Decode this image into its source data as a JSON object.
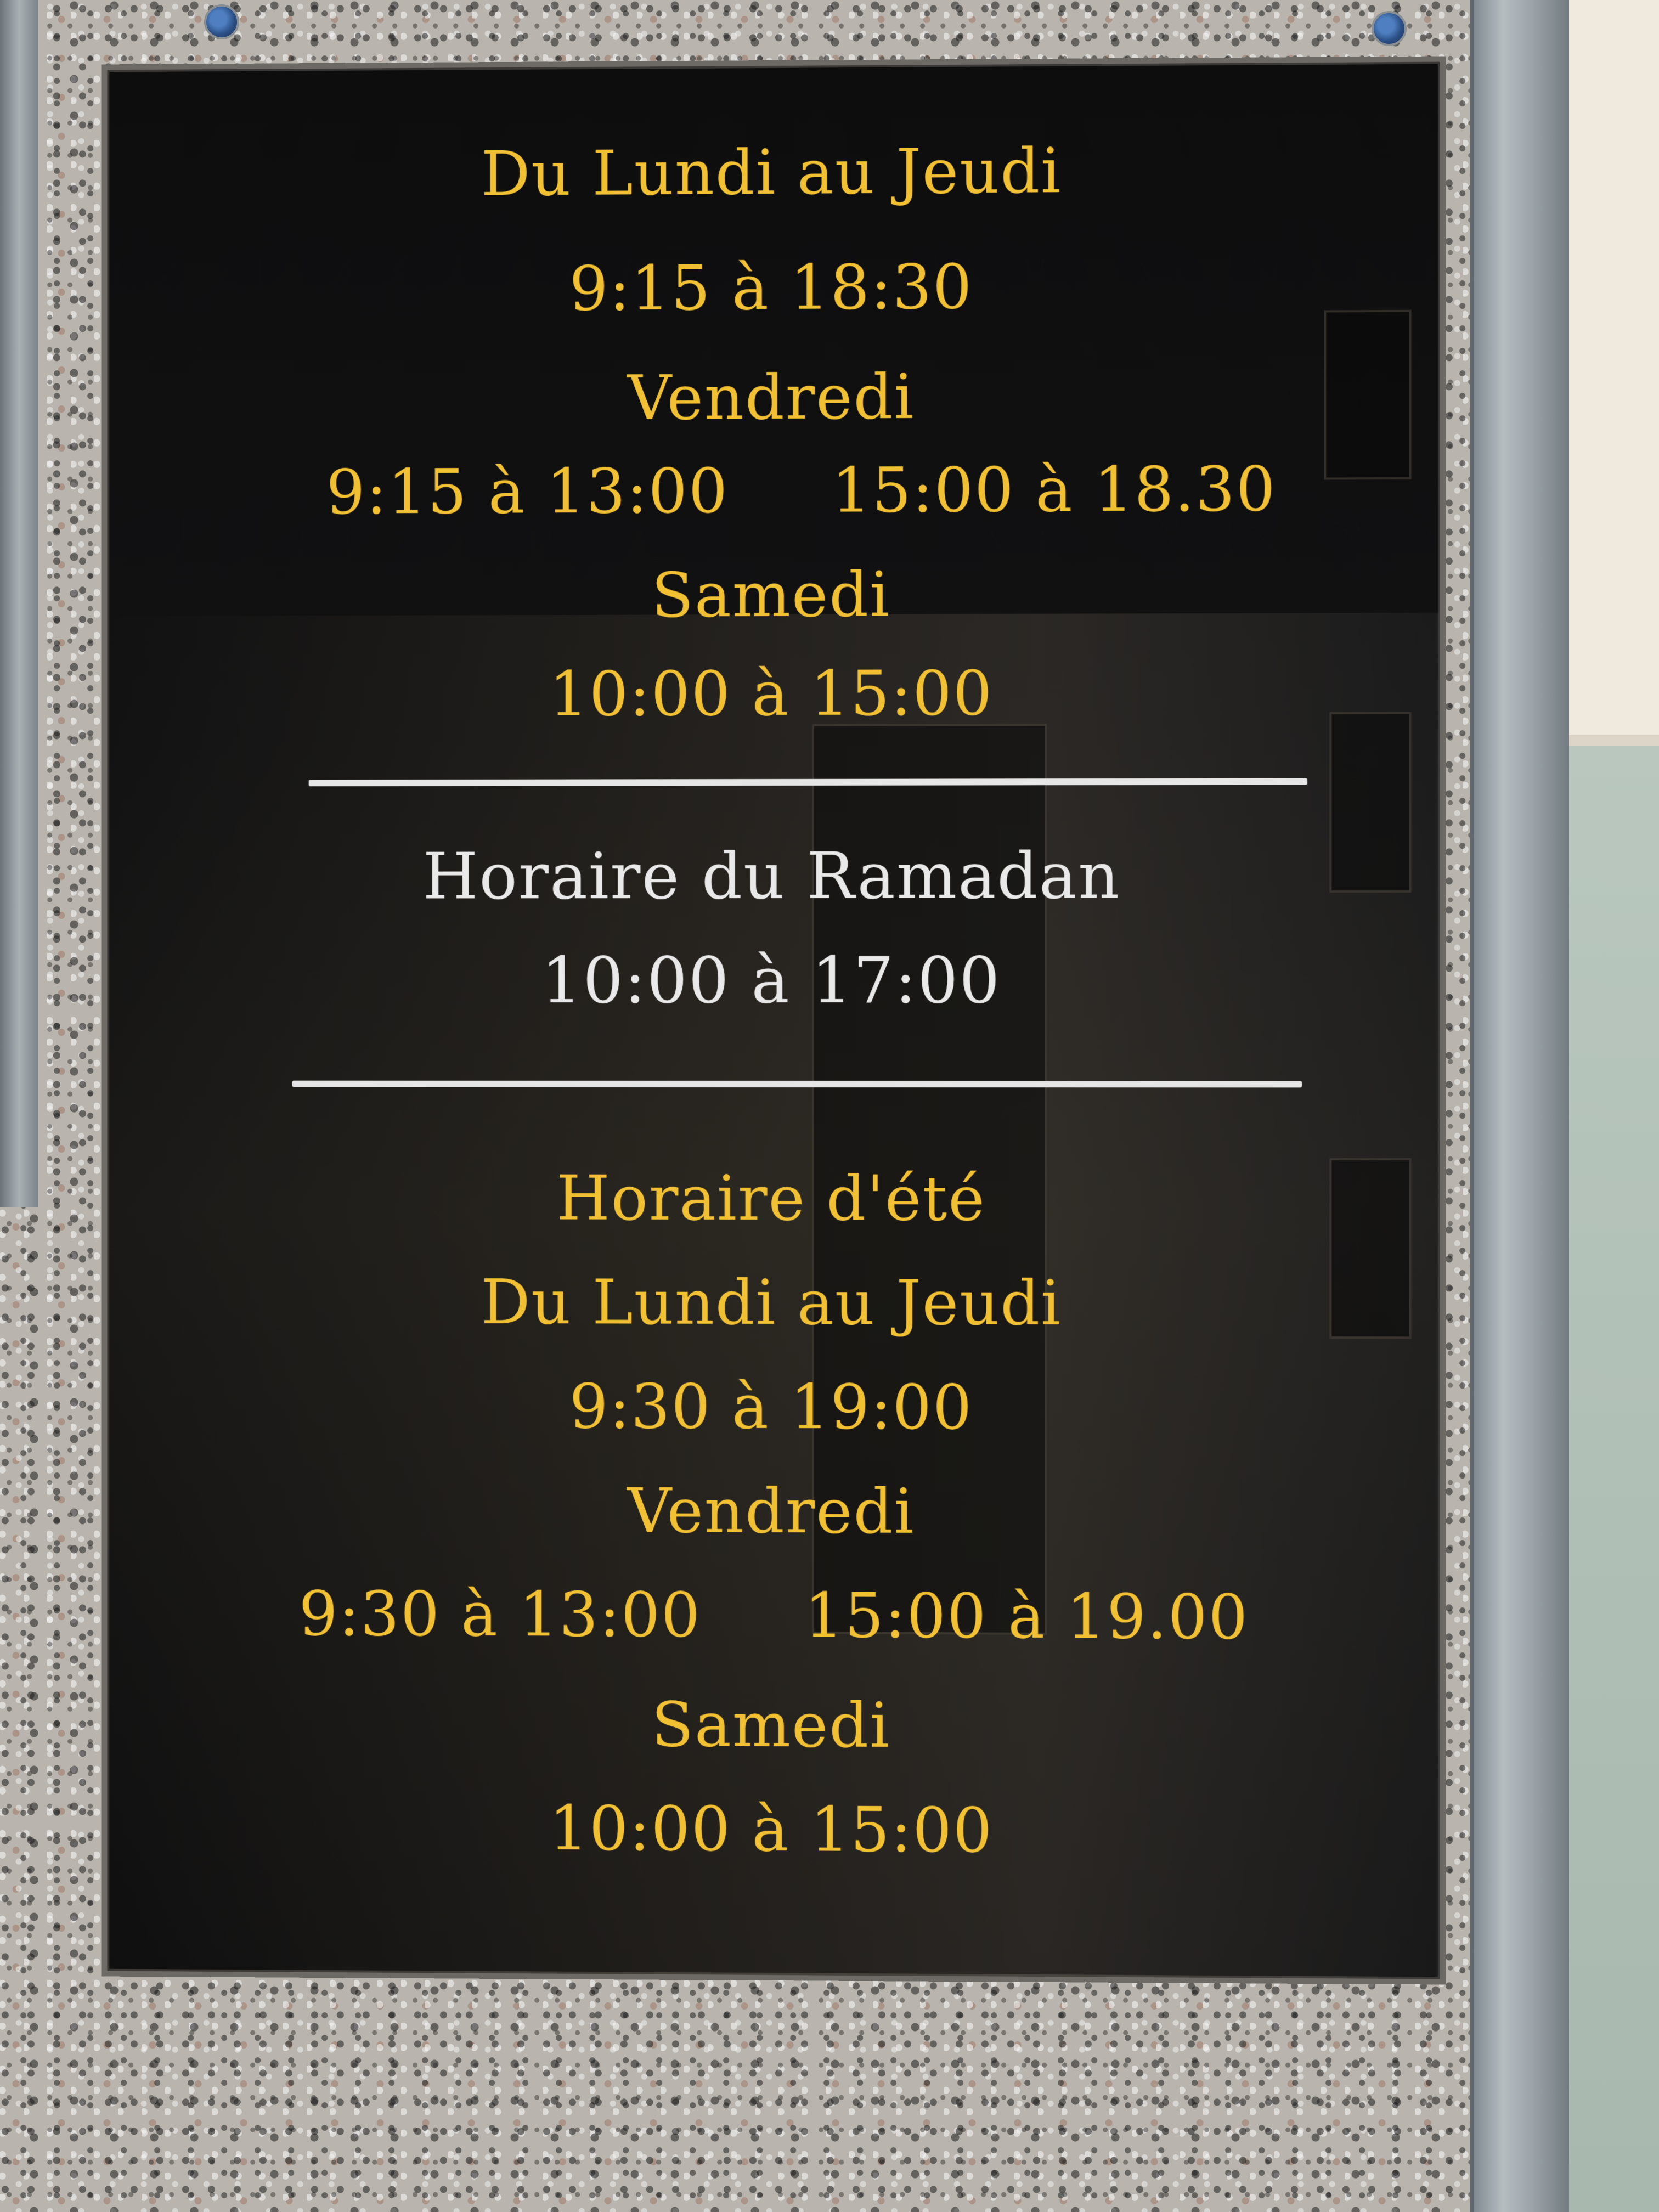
{
  "plaque": {
    "regular": {
      "weekdays_label": "Du Lundi au Jeudi",
      "weekdays_hours": "9:15 à 18:30",
      "friday_label": "Vendredi",
      "friday_morning": "9:15 à 13:00",
      "friday_afternoon": "15:00 à 18.30",
      "saturday_label": "Samedi",
      "saturday_hours": "10:00 à 15:00"
    },
    "ramadan": {
      "title": "Horaire du Ramadan",
      "hours": "10:00 à 17:00"
    },
    "summer": {
      "title": "Horaire d'été",
      "weekdays_label": "Du Lundi au Jeudi",
      "weekdays_hours": "9:30 à 19:00",
      "friday_label": "Vendredi",
      "friday_morning": "9:30 à 13:00",
      "friday_afternoon": "15:00 à 19.00",
      "saturday_label": "Samedi",
      "saturday_hours": "10:00 à 15:00"
    }
  },
  "colors": {
    "gold_text": "#f2c033",
    "white_text": "#e9e9e9",
    "plaque_background": "#111111"
  }
}
